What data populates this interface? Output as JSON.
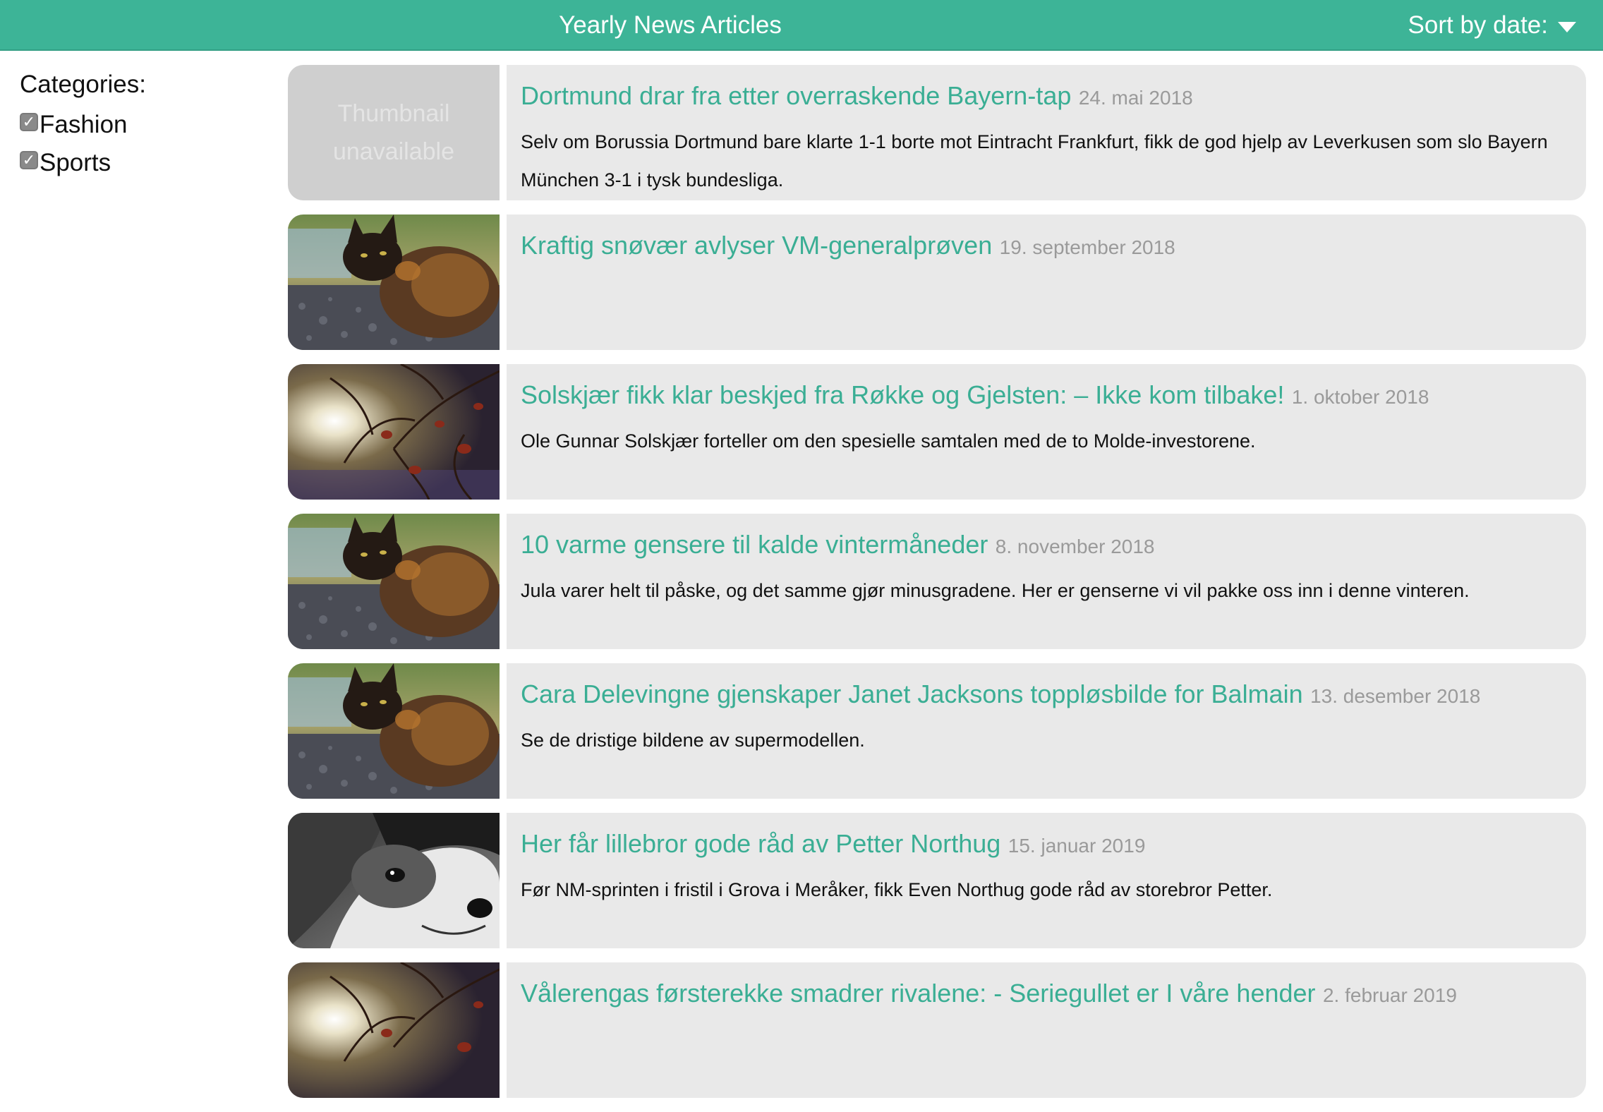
{
  "header": {
    "title": "Yearly News Articles",
    "sort_label": "Sort by date:"
  },
  "sidebar": {
    "title": "Categories:",
    "categories": [
      {
        "label": "Fashion",
        "checked": true
      },
      {
        "label": "Sports",
        "checked": true
      }
    ]
  },
  "thumbnail_unavailable": "Thumbnail unavailable",
  "articles": [
    {
      "title": "Dortmund drar fra etter overraskende Bayern-tap",
      "date": "24. mai 2018",
      "description": "Selv om Borussia Dortmund bare klarte 1-1 borte mot Eintracht Frankfurt, fikk de god hjelp av Leverkusen som slo Bayern München 3-1 i tysk bundesliga.",
      "thumbnail": "unavailable"
    },
    {
      "title": "Kraftig snøvær avlyser VM-generalprøven",
      "date": "19. september 2018",
      "description": "",
      "thumbnail": "cat-photo"
    },
    {
      "title": "Solskjær fikk klar beskjed fra Røkke og Gjelsten: – Ikke kom tilbake!",
      "date": "1. oktober 2018",
      "description": "Ole Gunnar Solskjær forteller om den spesielle samtalen med de to Molde-investorene.",
      "thumbnail": "branches-photo"
    },
    {
      "title": "10 varme gensere til kalde vintermåneder",
      "date": "8. november 2018",
      "description": "Jula varer helt til påske, og det samme gjør minusgradene. Her er genserne vi vil pakke oss inn i denne vinteren.",
      "thumbnail": "cat-photo"
    },
    {
      "title": "Cara Delevingne gjenskaper Janet Jacksons toppløsbilde for Balmain",
      "date": "13. desember 2018",
      "description": "Se de dristige bildene av supermodellen.",
      "thumbnail": "cat-photo"
    },
    {
      "title": "Her får lillebror gode råd av Petter Northug",
      "date": "15. januar 2019",
      "description": "Før NM-sprinten i fristil i Grova i Meråker, fikk Even Northug gode råd av storebror Petter.",
      "thumbnail": "dog-photo"
    },
    {
      "title": "Vålerengas førsterekke smadrer rivalene: - Seriegullet er I våre hender",
      "date": "2. februar 2019",
      "description": "",
      "thumbnail": "branches-photo"
    }
  ]
}
